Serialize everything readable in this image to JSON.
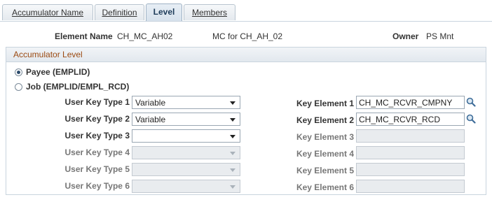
{
  "tabs": [
    {
      "label": "Accumulator Name",
      "active": false
    },
    {
      "label": "Definition",
      "active": false
    },
    {
      "label": "Level",
      "active": true
    },
    {
      "label": "Members",
      "active": false
    }
  ],
  "header": {
    "element_name_label": "Element Name",
    "element_name_value": "CH_MC_AH02",
    "description": "MC for CH_AH_02",
    "owner_label": "Owner",
    "owner_value": "PS Mnt"
  },
  "group": {
    "title": "Accumulator Level",
    "radio_payee": "Payee (EMPLID)",
    "radio_job": "Job (EMPLID/EMPL_RCD)",
    "selected": "payee"
  },
  "rows": [
    {
      "type_label": "User Key Type 1",
      "type_value": "Variable",
      "key_label": "Key Element 1",
      "key_value": "CH_MC_RCVR_CMPNY"
    },
    {
      "type_label": "User Key Type 2",
      "type_value": "Variable",
      "key_label": "Key Element 2",
      "key_value": "CH_MC_RCVR_RCD"
    },
    {
      "type_label": "User Key Type 3",
      "type_value": "",
      "key_label": "Key Element 3",
      "key_value": ""
    },
    {
      "type_label": "User Key Type 4",
      "type_value": "",
      "key_label": "Key Element 4",
      "key_value": ""
    },
    {
      "type_label": "User Key Type 5",
      "type_value": "",
      "key_label": "Key Element 5",
      "key_value": ""
    },
    {
      "type_label": "User Key Type 6",
      "type_value": "",
      "key_label": "Key Element 6",
      "key_value": ""
    }
  ],
  "colors": {
    "accent": "#9b4a12",
    "tab_active": "#1e3c5a"
  },
  "icons": {
    "lookup": "magnifier-icon"
  }
}
